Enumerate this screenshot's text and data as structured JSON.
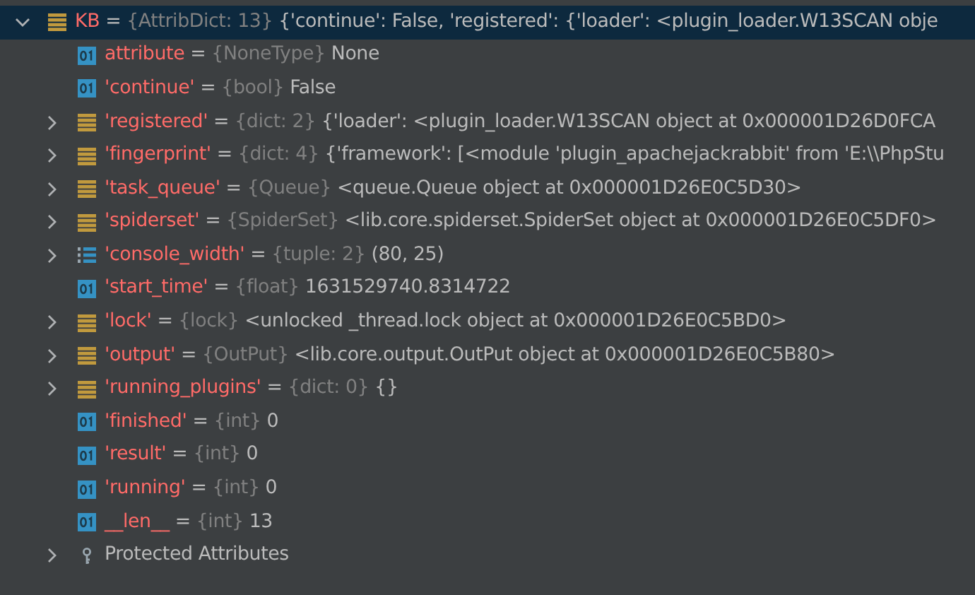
{
  "variables": [
    {
      "name": "KB",
      "sep": "=",
      "type": "{AttribDict: 13}",
      "value": "{'continue': False, 'registered': {'loader': <plugin_loader.W13SCAN obje",
      "kind": "dict",
      "expanded": true,
      "selected": true,
      "children": [
        {
          "name": "attribute",
          "sep": "=",
          "type": "{NoneType}",
          "value": "None",
          "kind": "primitive",
          "selected": false
        },
        {
          "name": "'continue'",
          "sep": "=",
          "type": "{bool}",
          "value": "False",
          "kind": "primitive",
          "selected": false
        },
        {
          "name": "'registered'",
          "sep": "=",
          "type": "{dict: 2}",
          "value": "{'loader': <plugin_loader.W13SCAN object at 0x000001D26D0FCA",
          "kind": "dict",
          "expanded": false,
          "selected": false
        },
        {
          "name": "'fingerprint'",
          "sep": "=",
          "type": "{dict: 4}",
          "value": "{'framework': [<module 'plugin_apachejackrabbit' from 'E:\\\\PhpStu",
          "kind": "dict",
          "expanded": false,
          "selected": false
        },
        {
          "name": "'task_queue'",
          "sep": "=",
          "type": "{Queue}",
          "value": "<queue.Queue object at 0x000001D26E0C5D30>",
          "kind": "dict",
          "expanded": false,
          "selected": false
        },
        {
          "name": "'spiderset'",
          "sep": "=",
          "type": "{SpiderSet}",
          "value": "<lib.core.spiderset.SpiderSet object at 0x000001D26E0C5DF0>",
          "kind": "dict",
          "expanded": false,
          "selected": false
        },
        {
          "name": "'console_width'",
          "sep": "=",
          "type": "{tuple: 2}",
          "value": "(80, 25)",
          "kind": "tuple",
          "expanded": false,
          "selected": false
        },
        {
          "name": "'start_time'",
          "sep": "=",
          "type": "{float}",
          "value": "1631529740.8314722",
          "kind": "primitive",
          "selected": false
        },
        {
          "name": "'lock'",
          "sep": "=",
          "type": "{lock}",
          "value": "<unlocked _thread.lock object at 0x000001D26E0C5BD0>",
          "kind": "dict",
          "expanded": false,
          "selected": false
        },
        {
          "name": "'output'",
          "sep": "=",
          "type": "{OutPut}",
          "value": "<lib.core.output.OutPut object at 0x000001D26E0C5B80>",
          "kind": "dict",
          "expanded": false,
          "selected": false
        },
        {
          "name": "'running_plugins'",
          "sep": "=",
          "type": "{dict: 0}",
          "value": "{}",
          "kind": "dict",
          "expanded": false,
          "selected": false
        },
        {
          "name": "'finished'",
          "sep": "=",
          "type": "{int}",
          "value": "0",
          "kind": "primitive",
          "selected": false
        },
        {
          "name": "'result'",
          "sep": "=",
          "type": "{int}",
          "value": "0",
          "kind": "primitive",
          "selected": false
        },
        {
          "name": "'running'",
          "sep": "=",
          "type": "{int}",
          "value": "0",
          "kind": "primitive",
          "selected": false
        },
        {
          "name": "__len__",
          "sep": "=",
          "type": "{int}",
          "value": "13",
          "kind": "primitive",
          "selected": false
        },
        {
          "name": "Protected Attributes",
          "kind": "protected",
          "expanded": false,
          "selected": false
        }
      ]
    }
  ]
}
